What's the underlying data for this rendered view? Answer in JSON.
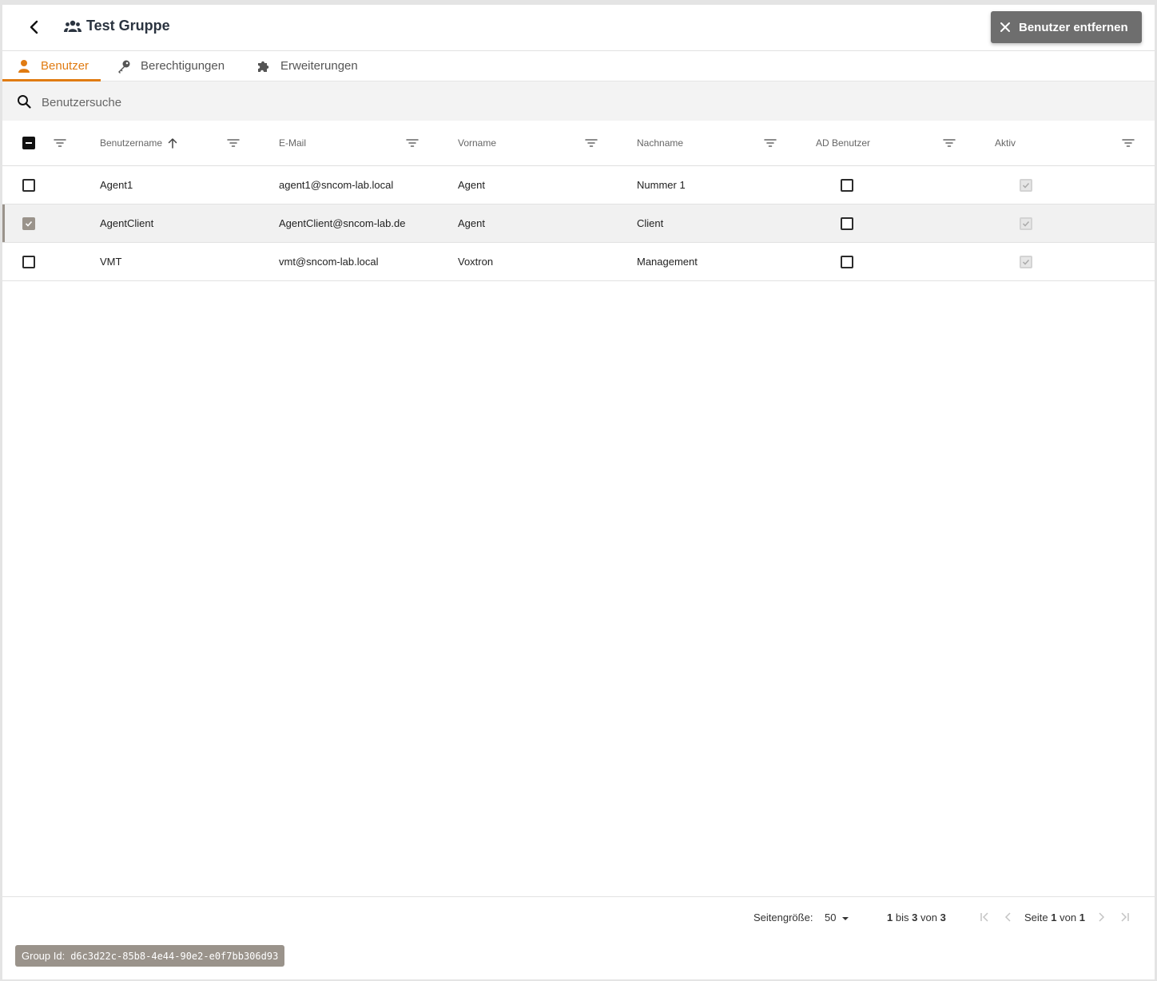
{
  "header": {
    "title": "Test Gruppe",
    "remove_button": "Benutzer entfernen"
  },
  "tabs": [
    {
      "label": "Benutzer",
      "icon": "person-icon",
      "active": true
    },
    {
      "label": "Berechtigungen",
      "icon": "key-icon",
      "active": false
    },
    {
      "label": "Erweiterungen",
      "icon": "puzzle-icon",
      "active": false
    }
  ],
  "search": {
    "placeholder": "Benutzersuche",
    "value": ""
  },
  "columns": {
    "username": "Benutzername",
    "email": "E-Mail",
    "firstname": "Vorname",
    "lastname": "Nachname",
    "ad_user": "AD Benutzer",
    "active": "Aktiv"
  },
  "sort": {
    "column": "Benutzername",
    "direction": "ascending"
  },
  "rows": [
    {
      "username": "Agent1",
      "email": "agent1@sncom-lab.local",
      "firstname": "Agent",
      "lastname": "Nummer 1",
      "ad_user": false,
      "active": true,
      "selected": false
    },
    {
      "username": "AgentClient",
      "email": "AgentClient@sncom-lab.de",
      "firstname": "Agent",
      "lastname": "Client",
      "ad_user": false,
      "active": true,
      "selected": true
    },
    {
      "username": "VMT",
      "email": "vmt@sncom-lab.local",
      "firstname": "Voxtron",
      "lastname": "Management",
      "ad_user": false,
      "active": true,
      "selected": false
    }
  ],
  "pagination": {
    "page_size_label": "Seitengröße:",
    "page_size": "50",
    "range_from": "1",
    "range_to": "3",
    "range_total": "3",
    "range_sep1": "bis",
    "range_sep2": "von",
    "page_label": "Seite",
    "page_current": "1",
    "page_of": "von",
    "page_total": "1"
  },
  "group_id": {
    "label": "Group Id:",
    "value": "d6c3d22c-85b8-4e44-90e2-e0f7bb306d93"
  },
  "colors": {
    "accent": "#e07b12",
    "selection": "#9a938b",
    "button": "#6e6e6e"
  }
}
